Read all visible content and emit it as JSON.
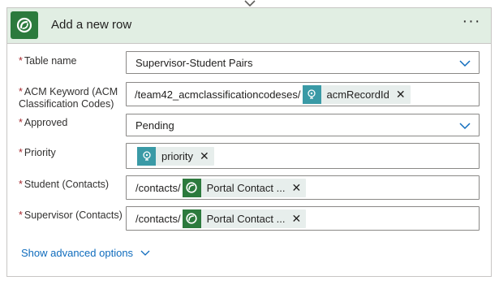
{
  "card": {
    "title": "Add a new row",
    "more_label": "···"
  },
  "fields": {
    "table_name": {
      "label": "Table name",
      "value": "Supervisor-Student Pairs"
    },
    "acm_keyword": {
      "label": "ACM Keyword (ACM Classification Codes)",
      "prefix": "/team42_acmclassificationcodeses/",
      "token": "acmRecordId"
    },
    "approved": {
      "label": "Approved",
      "value": "Pending"
    },
    "priority": {
      "label": "Priority",
      "token": "priority"
    },
    "student": {
      "label": "Student (Contacts)",
      "prefix": "/contacts/",
      "token": "Portal Contact ..."
    },
    "supervisor": {
      "label": "Supervisor (Contacts)",
      "prefix": "/contacts/",
      "token": "Portal Contact ..."
    }
  },
  "required_marker": "*",
  "token_close": "✕",
  "advanced_options": "Show advanced options",
  "colors": {
    "header_bg": "#e1eee3",
    "dataverse_green": "#2c7a3d",
    "variable_teal": "#3a9aa6",
    "link_blue": "#0f6cbd",
    "required_red": "#a4262c"
  },
  "icons": {
    "app": "dataverse-icon",
    "variable": "variable-icon",
    "dropdown": "chevron-down-icon"
  }
}
